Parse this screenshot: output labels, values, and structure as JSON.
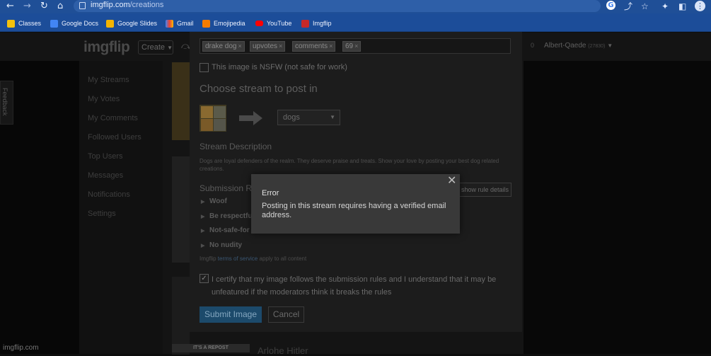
{
  "browser": {
    "url_domain": "imgflip.com",
    "url_path": "/creations",
    "bookmarks": [
      {
        "label": "Classes",
        "icon": "classes-icon",
        "color": "#f4c20d"
      },
      {
        "label": "Google Docs",
        "icon": "google-docs-icon",
        "color": "#4285f4"
      },
      {
        "label": "Google Slides",
        "icon": "google-slides-icon",
        "color": "#f4b400"
      },
      {
        "label": "Gmail",
        "icon": "gmail-icon",
        "color": "#ea4335"
      },
      {
        "label": "Emojipedia",
        "icon": "emojipedia-icon",
        "color": "#f57c00"
      },
      {
        "label": "YouTube",
        "icon": "youtube-icon",
        "color": "#ff0000"
      },
      {
        "label": "Imgflip",
        "icon": "imgflip-icon",
        "color": "#c62828"
      }
    ]
  },
  "site": {
    "logo": "imgflip",
    "create_label": "Create",
    "user_count": "0",
    "user_label": "Albert-Qaede",
    "user_points": "(27830)",
    "feedback_label": "Feedback",
    "sidebar": [
      "My Streams",
      "My Votes",
      "My Comments",
      "Followed Users",
      "Top Users",
      "Messages",
      "Notifications",
      "Settings"
    ],
    "footer_credit": "imgflip.com",
    "bottom_post_title": "Arlohe Hitler",
    "bottom_report_label": "IT'S A REPOST"
  },
  "submit_form": {
    "tags": [
      "drake dog",
      "upvotes",
      "comments",
      "69"
    ],
    "nsfw_label": "This image is NSFW (not safe for work)",
    "choose_stream_heading": "Choose stream to post in",
    "selected_stream": "dogs",
    "stream_description_heading": "Stream Description",
    "stream_description": "Dogs are loyal defenders of the realm. They deserve praise and treats. Show your love by posting your best dog related creations.",
    "submission_rules_heading": "Submission R",
    "show_rules_label": "show rule details",
    "rules": [
      "Woof",
      "Be respectfu",
      "Not-safe-for",
      "No nudity"
    ],
    "tos_prefix": "Imgflip ",
    "tos_link": "terms of service",
    "tos_suffix": " apply to all content",
    "certify_text": "I certify that my image follows the submission rules and I understand that it may be unfeatured if the moderators think it breaks the rules",
    "submit_label": "Submit Image",
    "cancel_label": "Cancel"
  },
  "error_dialog": {
    "title": "Error",
    "message": "Posting in this stream requires having a verified email address."
  }
}
